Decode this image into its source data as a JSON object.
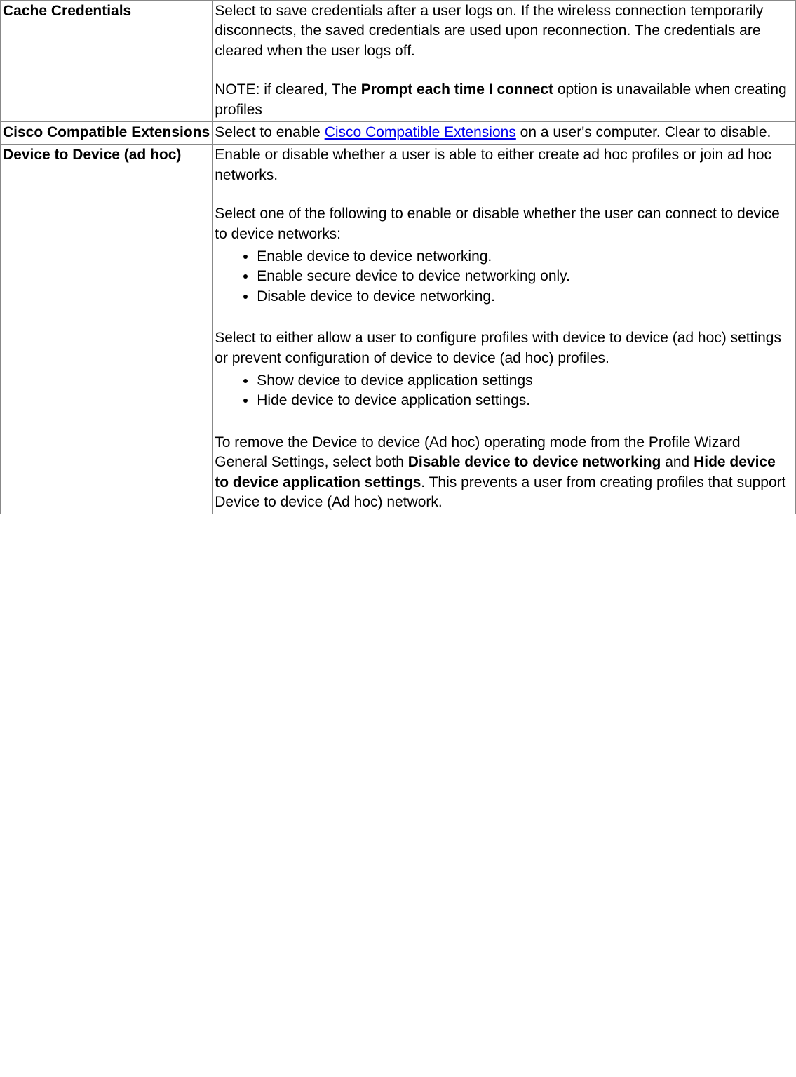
{
  "rows": {
    "cache": {
      "label": "Cache Credentials",
      "p1": "Select to save credentials after a user logs on. If the wireless connection temporarily disconnects, the saved credentials are used upon reconnection. The credentials are cleared when the user logs off.",
      "note_pre": "NOTE: if cleared, The ",
      "note_bold": "Prompt each time I connect",
      "note_post": " option is unavailable when creating profiles"
    },
    "cisco": {
      "label": "Cisco Compatible Extensions",
      "pre": "Select to enable ",
      "link_text": "Cisco Compatible Extensions",
      "post": " on a user's computer. Clear to disable."
    },
    "d2d": {
      "label": "Device to Device (ad hoc)",
      "p1": "Enable or disable whether a user is able to either create ad hoc profiles or join ad hoc networks.",
      "p2": "Select one of the following to enable or disable whether the user can connect to device to device networks:",
      "list1": {
        "i1": "Enable device to device networking.",
        "i2": "Enable secure device to device networking only.",
        "i3": "Disable device to device networking."
      },
      "p3": "Select to either allow a user to configure profiles with device to device (ad hoc) settings or prevent configuration of device to device (ad hoc) profiles.",
      "list2": {
        "i1": "Show device to device application settings",
        "i2": "Hide device to device application settings."
      },
      "p4_pre": "To remove the Device to device (Ad hoc) operating mode from the Profile Wizard General Settings, select both ",
      "p4_b1": "Disable device to device networking",
      "p4_mid": " and ",
      "p4_b2": "Hide device to device application settings",
      "p4_post": ". This prevents a user from creating profiles that support Device to device (Ad hoc) network."
    }
  }
}
